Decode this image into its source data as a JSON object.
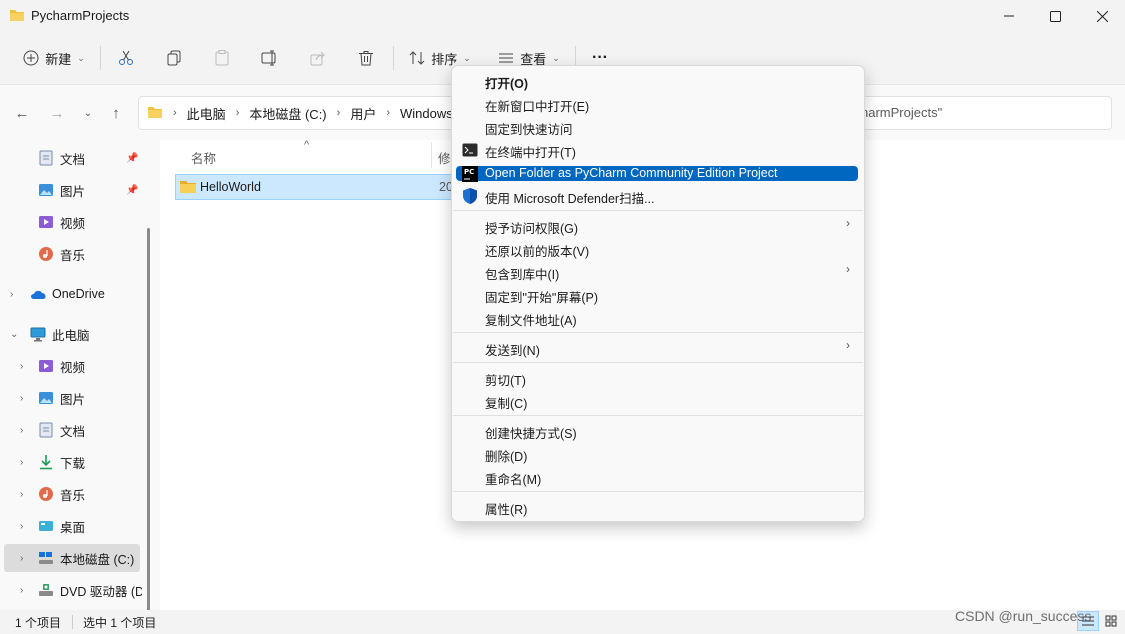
{
  "window": {
    "title": "PycharmProjects",
    "buttons": [
      "minimize",
      "maximize",
      "close"
    ]
  },
  "toolbar": {
    "new_label": "新建",
    "sort_label": "排序",
    "view_label": "查看",
    "more_label": "···"
  },
  "address": {
    "segments": [
      "此电脑",
      "本地磁盘 (C:)",
      "用户",
      "Windows1"
    ],
    "search_placeholder": "harmProjects\""
  },
  "sidebar": {
    "items": [
      {
        "label": "文档",
        "icon": "document-icon",
        "pinned": true
      },
      {
        "label": "图片",
        "icon": "pictures-icon",
        "pinned": true
      },
      {
        "label": "视频",
        "icon": "video-icon"
      },
      {
        "label": "音乐",
        "icon": "music-icon"
      },
      {
        "label": "OneDrive",
        "icon": "onedrive-icon"
      },
      {
        "label": "此电脑",
        "icon": "this-pc-icon"
      },
      {
        "label": "视频",
        "icon": "video-icon"
      },
      {
        "label": "图片",
        "icon": "pictures-icon"
      },
      {
        "label": "文档",
        "icon": "document-icon"
      },
      {
        "label": "下载",
        "icon": "download-icon"
      },
      {
        "label": "音乐",
        "icon": "music-icon"
      },
      {
        "label": "桌面",
        "icon": "desktop-icon"
      },
      {
        "label": "本地磁盘 (C:)",
        "icon": "drive-icon",
        "selected": true
      },
      {
        "label": "DVD 驱动器 (D",
        "icon": "dvd-icon"
      }
    ]
  },
  "content": {
    "col_name": "名称",
    "col_modified": "修",
    "rows": [
      {
        "name": "HelloWorld",
        "date": "20"
      }
    ]
  },
  "context_menu": {
    "items": [
      {
        "label": "打开(O)",
        "bold": true
      },
      {
        "label": "在新窗口中打开(E)"
      },
      {
        "label": "固定到快速访问"
      },
      {
        "label": "在终端中打开(T)",
        "icon": "terminal-icon"
      },
      {
        "label": "Open Folder as PyCharm Community Edition Project",
        "icon": "pycharm-icon",
        "highlighted": true
      },
      {
        "label": "使用 Microsoft Defender扫描...",
        "icon": "defender-shield-icon"
      },
      {
        "label": "授予访问权限(G)",
        "submenu": true
      },
      {
        "label": "还原以前的版本(V)"
      },
      {
        "label": "包含到库中(I)",
        "submenu": true
      },
      {
        "label": "固定到\"开始\"屏幕(P)"
      },
      {
        "label": "复制文件地址(A)"
      },
      {
        "label": "发送到(N)",
        "submenu": true
      },
      {
        "label": "剪切(T)"
      },
      {
        "label": "复制(C)"
      },
      {
        "label": "创建快捷方式(S)"
      },
      {
        "label": "删除(D)"
      },
      {
        "label": "重命名(M)"
      },
      {
        "label": "属性(R)"
      }
    ]
  },
  "status": {
    "count": "1 个项目",
    "selected": "选中 1 个项目"
  },
  "watermark": "CSDN @run_success",
  "colors": {
    "accent": "#0067c0",
    "selection": "#cce8ff",
    "folder": "#f3c042"
  }
}
